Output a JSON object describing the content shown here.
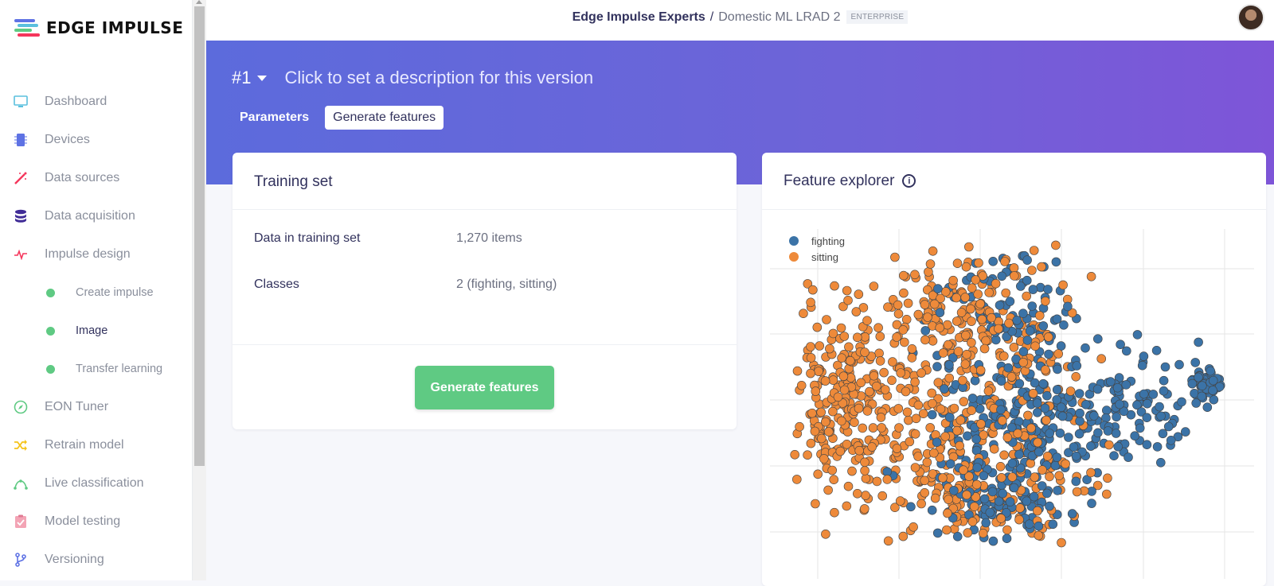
{
  "brand": {
    "name": "EDGE IMPULSE"
  },
  "sidebar": {
    "items": [
      {
        "label": "Dashboard",
        "icon": "monitor-icon",
        "color": "#5bc0de"
      },
      {
        "label": "Devices",
        "icon": "chip-icon",
        "color": "#5e72e4"
      },
      {
        "label": "Data sources",
        "icon": "wand-icon",
        "color": "#f5365c"
      },
      {
        "label": "Data acquisition",
        "icon": "database-icon",
        "color": "#3f2b96"
      },
      {
        "label": "Impulse design",
        "icon": "pulse-icon",
        "color": "#f5365c"
      }
    ],
    "sub_items": [
      {
        "label": "Create impulse"
      },
      {
        "label": "Image"
      },
      {
        "label": "Transfer learning"
      }
    ],
    "items2": [
      {
        "label": "EON Tuner",
        "icon": "compass-icon",
        "color": "#5fca83"
      },
      {
        "label": "Retrain model",
        "icon": "shuffle-icon",
        "color": "#f5c31b"
      },
      {
        "label": "Live classification",
        "icon": "curve-icon",
        "color": "#5fca83"
      },
      {
        "label": "Model testing",
        "icon": "clipboard-check-icon",
        "color": "#f3a4b5"
      },
      {
        "label": "Versioning",
        "icon": "branch-icon",
        "color": "#5e72e4"
      }
    ]
  },
  "topbar": {
    "org": "Edge Impulse Experts",
    "separator": "/",
    "project": "Domestic ML LRAD 2",
    "badge": "ENTERPRISE"
  },
  "hero": {
    "version": "#1",
    "description": "Click to set a description for this version",
    "tabs": [
      "Parameters",
      "Generate features"
    ]
  },
  "training": {
    "title": "Training set",
    "rows": [
      {
        "key": "Data in training set",
        "value": "1,270 items"
      },
      {
        "key": "Classes",
        "value": "2 (fighting, sitting)"
      }
    ],
    "button": "Generate features"
  },
  "explorer": {
    "title": "Feature explorer",
    "info_icon": "i",
    "colors": {
      "fighting": "#3b73a7",
      "sitting": "#ee8a3a"
    }
  },
  "chart_data": {
    "type": "scatter",
    "title": "",
    "xlabel": "",
    "ylabel": "",
    "legend": "top-left",
    "grid": true,
    "series": [
      {
        "name": "fighting",
        "color": "#3b73a7",
        "count": 540
      },
      {
        "name": "sitting",
        "color": "#ee8a3a",
        "count": 730
      }
    ]
  }
}
